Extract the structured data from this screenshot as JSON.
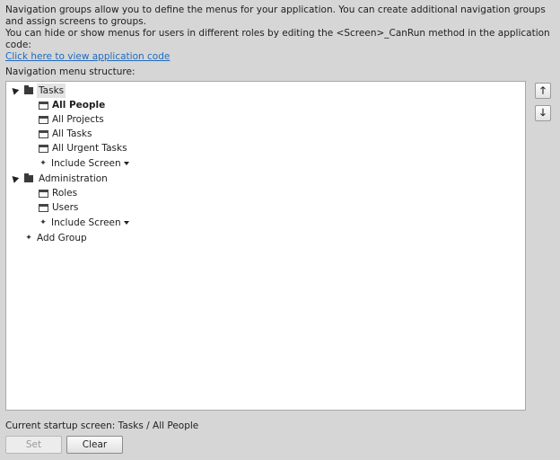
{
  "intro": {
    "line1": "Navigation groups allow you to define the menus for your application. You can create additional navigation groups and assign screens to groups.",
    "line2": "You can hide or show menus for users in different roles by editing the <Screen>_CanRun method in the application code:",
    "link": "Click here to view application code"
  },
  "structure_label": "Navigation menu structure:",
  "tree": {
    "groups": [
      {
        "label": "Tasks",
        "screens": [
          "All People",
          "All Projects",
          "All Tasks",
          "All Urgent Tasks"
        ],
        "include_label": "Include Screen"
      },
      {
        "label": "Administration",
        "screens": [
          "Roles",
          "Users"
        ],
        "include_label": "Include Screen"
      }
    ],
    "add_group": "Add Group"
  },
  "side_buttons": {
    "up": "🡑",
    "down": "🡓"
  },
  "startup": "Current startup screen: Tasks / All People",
  "buttons": {
    "set": "Set",
    "clear": "Clear"
  }
}
